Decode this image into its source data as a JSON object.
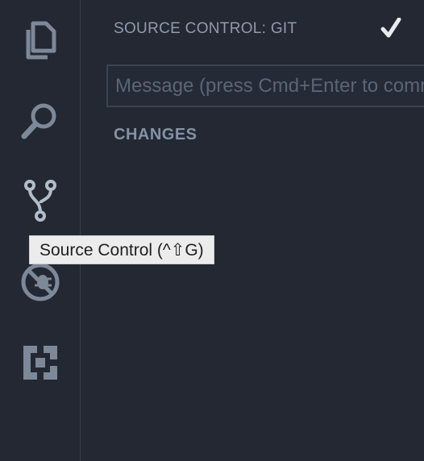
{
  "activity_bar": {
    "items": [
      {
        "id": "explorer",
        "icon": "files-icon"
      },
      {
        "id": "search",
        "icon": "search-icon"
      },
      {
        "id": "scm",
        "icon": "source-control-icon",
        "active": true
      },
      {
        "id": "debug",
        "icon": "no-debug-icon"
      },
      {
        "id": "extensions",
        "icon": "extensions-icon"
      }
    ]
  },
  "tooltip": {
    "text": "Source Control (^⇧G)"
  },
  "sidebar": {
    "title": "SOURCE CONTROL: GIT",
    "commit_icon": "checkmark-icon",
    "message_placeholder": "Message (press Cmd+Enter to commit)",
    "message_value": "",
    "changes_label": "CHANGES"
  },
  "colors": {
    "background": "#232833",
    "icon": "#7d8898",
    "active_icon": "#b3bcc9",
    "tooltip_bg": "#ececec"
  }
}
